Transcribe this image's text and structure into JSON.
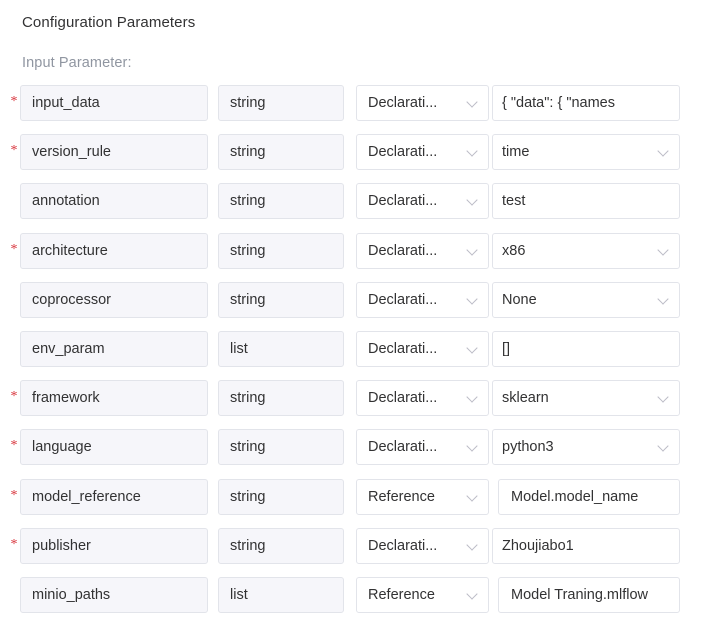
{
  "header": {
    "section_title": "Configuration Parameters",
    "sub_title": "Input Parameter:"
  },
  "icons": {
    "chevron_down": "chevron-down-icon",
    "required_marker": "*"
  },
  "colors": {
    "required_star": "#d9363e",
    "field_fill_readonly": "#f6f6fa",
    "field_fill_value": "#ffffff",
    "field_border": "#e2e4ea",
    "text_primary": "#323233",
    "text_muted": "#9096a1",
    "caret": "#bcbcc6"
  },
  "parameters": [
    {
      "required": true,
      "name": "input_data",
      "type": "string",
      "kind": "Declarati...",
      "value": "{  \"data\": {    \"names",
      "value_has_caret": false,
      "value_is_reference": false
    },
    {
      "required": true,
      "name": "version_rule",
      "type": "string",
      "kind": "Declarati...",
      "value": "time",
      "value_has_caret": true,
      "value_is_reference": false
    },
    {
      "required": false,
      "name": "annotation",
      "type": "string",
      "kind": "Declarati...",
      "value": "test",
      "value_has_caret": false,
      "value_is_reference": false
    },
    {
      "required": true,
      "name": "architecture",
      "type": "string",
      "kind": "Declarati...",
      "value": "x86",
      "value_has_caret": true,
      "value_is_reference": false
    },
    {
      "required": false,
      "name": "coprocessor",
      "type": "string",
      "kind": "Declarati...",
      "value": "None",
      "value_has_caret": true,
      "value_is_reference": false
    },
    {
      "required": false,
      "name": "env_param",
      "type": "list",
      "kind": "Declarati...",
      "value": "[]",
      "value_has_caret": false,
      "value_is_reference": false
    },
    {
      "required": true,
      "name": "framework",
      "type": "string",
      "kind": "Declarati...",
      "value": "sklearn",
      "value_has_caret": true,
      "value_is_reference": false
    },
    {
      "required": true,
      "name": "language",
      "type": "string",
      "kind": "Declarati...",
      "value": "python3",
      "value_has_caret": true,
      "value_is_reference": false
    },
    {
      "required": true,
      "name": "model_reference",
      "type": "string",
      "kind": "Reference",
      "value": "Model.model_name",
      "value_has_caret": false,
      "value_is_reference": true
    },
    {
      "required": true,
      "name": "publisher",
      "type": "string",
      "kind": "Declarati...",
      "value": "Zhoujiabo1",
      "value_has_caret": false,
      "value_is_reference": false
    },
    {
      "required": false,
      "name": "minio_paths",
      "type": "list",
      "kind": "Reference",
      "value": "Model Traning.mlflow",
      "value_has_caret": false,
      "value_is_reference": true
    }
  ]
}
